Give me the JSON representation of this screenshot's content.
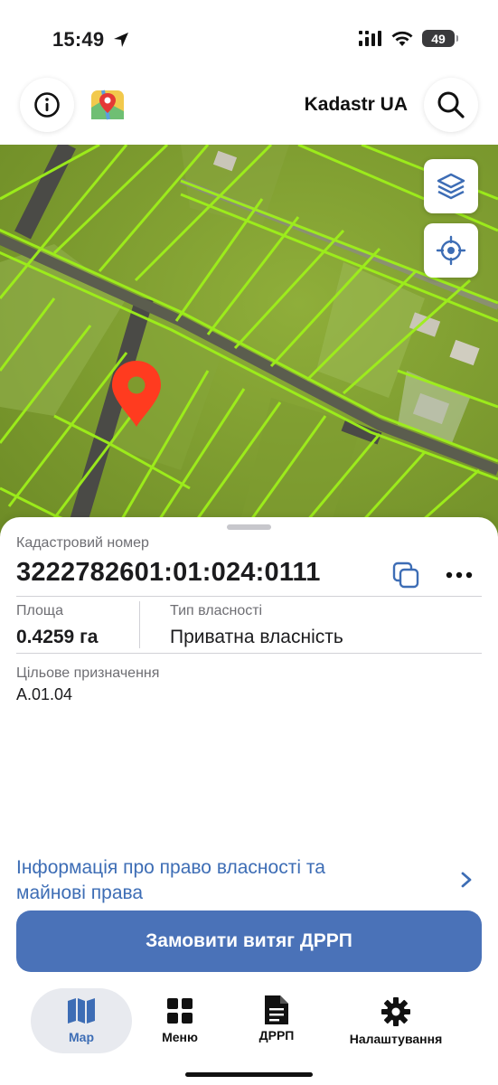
{
  "status_bar": {
    "time": "15:49",
    "battery": "49"
  },
  "header": {
    "title": "Kadastr UA"
  },
  "icons": {
    "info": "info-icon",
    "logo": "map-pin-logo-icon",
    "search": "search-icon",
    "layers": "layers-icon",
    "locate": "crosshair-icon",
    "copy": "copy-icon",
    "more": "more-horizontal-icon",
    "chevron": "chevron-right-icon",
    "tab_map": "map-icon",
    "tab_menu": "grid-icon",
    "tab_drrp": "document-icon",
    "tab_settings": "gear-icon"
  },
  "parcel": {
    "cad_label": "Кадастровий номер",
    "cad_number": "3222782601:01:024:0111",
    "area_label": "Площа",
    "area_value": "0.4259 га",
    "ownership_label": "Тип власності",
    "ownership_value": "Приватна власність",
    "purpose_label": "Цільове призначення",
    "purpose_value": "A.01.04"
  },
  "actions": {
    "rights_link_line1": "Інформація про право власності та",
    "rights_link_line2": "майнові права",
    "order_button": "Замовити витяг ДРРП"
  },
  "tabbar": {
    "map": "Map",
    "menu": "Меню",
    "drrp": "ДРРП",
    "settings": "Налаштування"
  },
  "colors": {
    "accent": "#4a72b8",
    "link": "#3d6db5",
    "parcel_outline": "#9ef01a",
    "pin": "#ff3b1f"
  }
}
